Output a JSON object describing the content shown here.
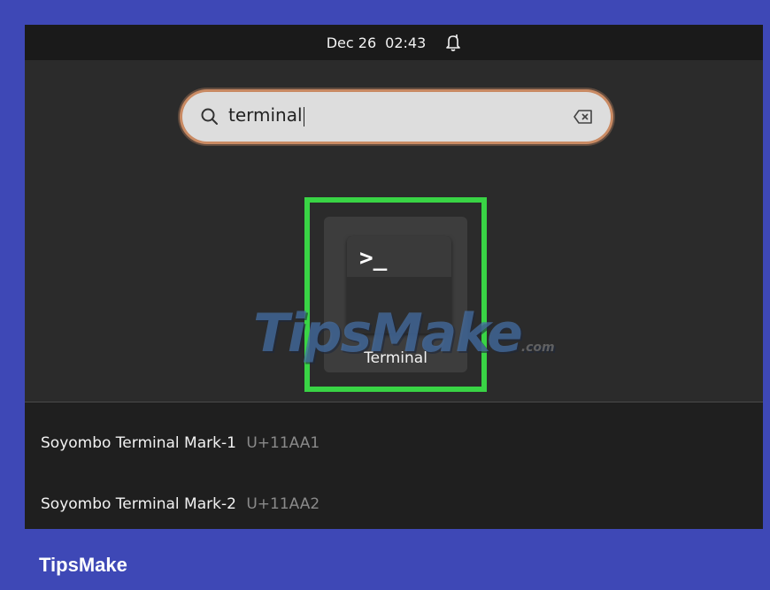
{
  "topbar": {
    "date": "Dec 26",
    "time": "02:43",
    "notification_icon": "bell-icon"
  },
  "search": {
    "value": "terminal",
    "search_icon": "search-icon",
    "clear_icon": "backspace-clear-icon"
  },
  "app_result": {
    "label": "Terminal",
    "icon_prompt": ">_",
    "icon": "terminal-icon",
    "highlight_color": "#39d445"
  },
  "results": [
    {
      "name": "Soyombo Terminal Mark-1",
      "code": "U+11AA1"
    },
    {
      "name": "Soyombo Terminal Mark-2",
      "code": "U+11AA2"
    }
  ],
  "watermark": {
    "text": "TipsMake",
    "suffix": ".com"
  },
  "brand": {
    "label": "TipsMake"
  },
  "colors": {
    "frame": "#3e48b6",
    "search_ring": "#c98a63"
  }
}
